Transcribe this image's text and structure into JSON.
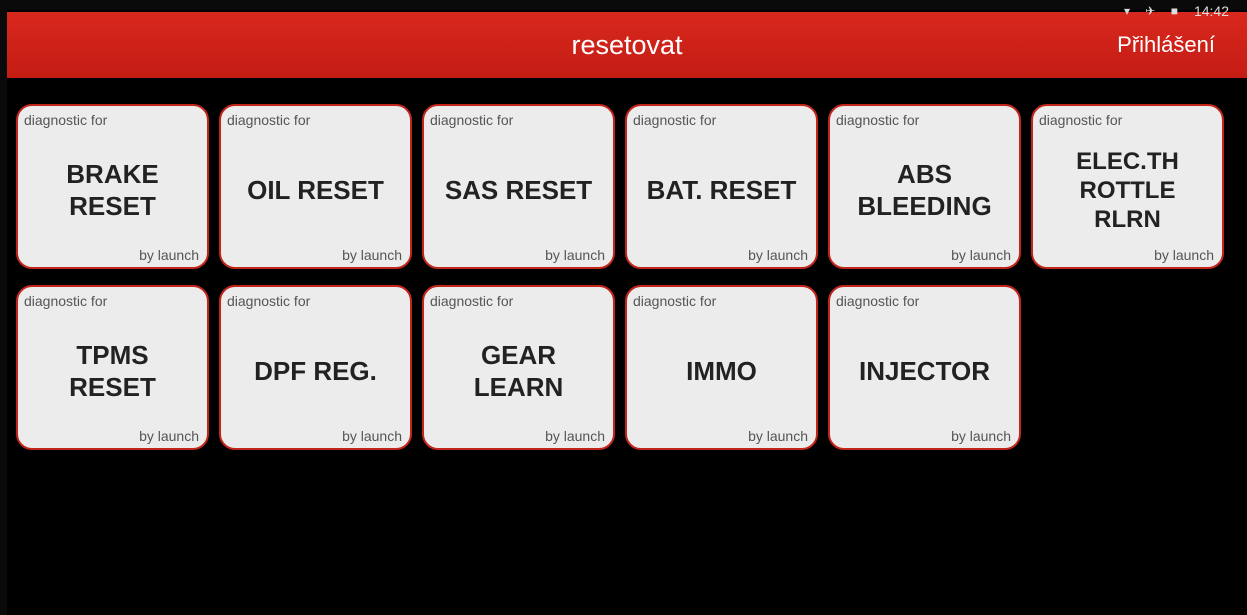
{
  "status_bar": {
    "time": "14:42"
  },
  "header": {
    "title": "resetovat",
    "login": "Přihlášení"
  },
  "tiles": [
    {
      "top": "diagnostic for",
      "name": "BRAKE\nRESET",
      "bottom": "by launch"
    },
    {
      "top": "diagnostic for",
      "name": "OIL RESET",
      "bottom": "by launch"
    },
    {
      "top": "diagnostic for",
      "name": "SAS RESET",
      "bottom": "by launch"
    },
    {
      "top": "diagnostic for",
      "name": "BAT. RESET",
      "bottom": "by launch"
    },
    {
      "top": "diagnostic for",
      "name": "ABS\nBLEEDING",
      "bottom": "by launch"
    },
    {
      "top": "diagnostic for",
      "name": "ELEC.TH\nROTTLE\nRLRN",
      "bottom": "by launch"
    },
    {
      "top": "diagnostic for",
      "name": "TPMS\nRESET",
      "bottom": "by launch"
    },
    {
      "top": "diagnostic for",
      "name": "DPF REG.",
      "bottom": "by launch"
    },
    {
      "top": "diagnostic for",
      "name": "GEAR\nLEARN",
      "bottom": "by launch"
    },
    {
      "top": "diagnostic for",
      "name": "IMMO",
      "bottom": "by launch"
    },
    {
      "top": "diagnostic for",
      "name": "INJECTOR",
      "bottom": "by launch"
    }
  ]
}
